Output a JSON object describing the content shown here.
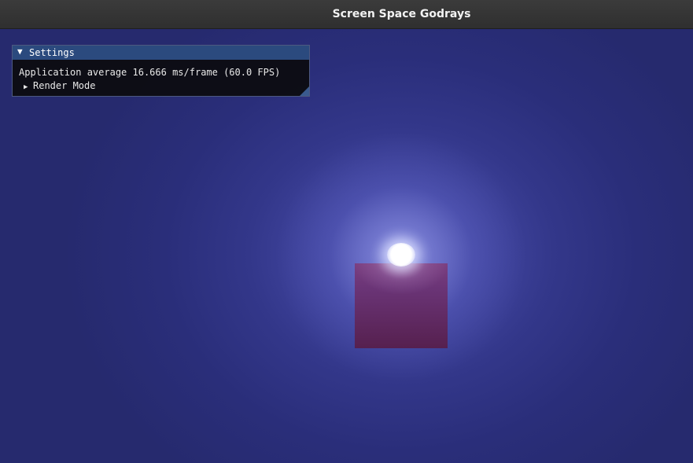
{
  "window": {
    "title": "Screen Space Godrays"
  },
  "settings": {
    "header_arrow_icon": "triangle-down-icon",
    "header_arrow": "▼",
    "header_label": "Settings",
    "fps_text": "Application average 16.666 ms/frame (60.0 FPS)",
    "render_mode": {
      "arrow_icon": "triangle-right-icon",
      "arrow": "▶",
      "label": "Render Mode"
    }
  },
  "scene": {
    "background_color": "#262a6e",
    "cube_color": "#6a3476",
    "sun_color": "#ffffff"
  }
}
